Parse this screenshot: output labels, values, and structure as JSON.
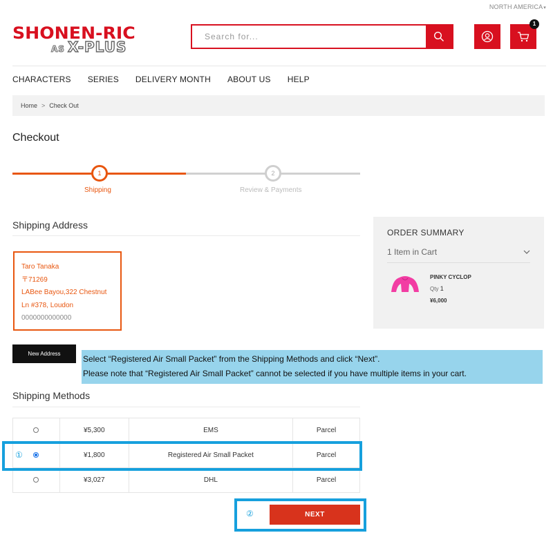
{
  "header": {
    "region": "NORTH AMERICA",
    "logo_line1": "SHONEN-RIC",
    "logo_as": "AS",
    "logo_line2": "X-PLUS",
    "search_placeholder": "Search for...",
    "cart_count": "1",
    "brand_color": "#d8101f"
  },
  "nav": {
    "items": [
      "CHARACTERS",
      "SERIES",
      "DELIVERY MONTH",
      "ABOUT US",
      "HELP"
    ]
  },
  "breadcrumb": {
    "home": "Home",
    "separator": ">",
    "current": "Check Out"
  },
  "checkout": {
    "title": "Checkout",
    "steps": [
      {
        "number": "1",
        "label": "Shipping",
        "state": "active"
      },
      {
        "number": "2",
        "label": "Review & Payments",
        "state": "pending"
      }
    ],
    "accent_color": "#e8560f"
  },
  "shipping_address": {
    "title": "Shipping Address",
    "name": "Taro Tanaka",
    "postal": "〒71269",
    "line1": "LABee Bayou,322 Chestnut",
    "line2": "Ln #378, Loudon",
    "phone": "0000000000000",
    "new_address_label": "New Address"
  },
  "note": {
    "line1": "Select “Registered Air Small Packet” from the Shipping Methods and click “Next”.",
    "line2": "Please note that “Registered Air Small Packet” cannot be selected if you have multiple items in your cart.",
    "color": "#97d4ec"
  },
  "shipping_methods": {
    "title": "Shipping Methods",
    "rows": [
      {
        "price": "¥5,300",
        "name": "EMS",
        "type": "Parcel",
        "selected": false
      },
      {
        "price": "¥1,800",
        "name": "Registered Air Small Packet",
        "type": "Parcel",
        "selected": true
      },
      {
        "price": "¥3,027",
        "name": "DHL",
        "type": "Parcel",
        "selected": false
      }
    ]
  },
  "annotations": {
    "marker1": "①",
    "marker2": "②",
    "highlight_color": "#16a0dd"
  },
  "actions": {
    "next_label": "NEXT"
  },
  "order_summary": {
    "title": "ORDER SUMMARY",
    "items_in_cart": "1 Item in Cart",
    "item": {
      "name": "PINKY CYCLOP",
      "qty_label": "Qty",
      "qty": "1",
      "price": "¥6,000"
    }
  }
}
